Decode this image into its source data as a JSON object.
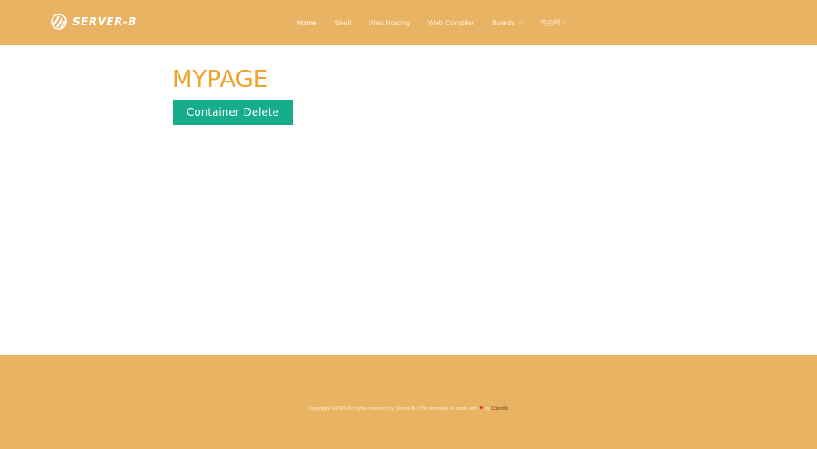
{
  "header": {
    "logo_text": "SERVER-B",
    "nav": [
      {
        "label": "Home",
        "active": true,
        "dropdown": false
      },
      {
        "label": "Shell",
        "active": false,
        "dropdown": false
      },
      {
        "label": "Web Hosting",
        "active": false,
        "dropdown": false
      },
      {
        "label": "Web Compiler",
        "active": false,
        "dropdown": false
      },
      {
        "label": "Boards",
        "active": false,
        "dropdown": true
      },
      {
        "label": "백승혁",
        "active": false,
        "dropdown": true
      }
    ]
  },
  "main": {
    "title": "MYPAGE",
    "delete_button": "Container Delete"
  },
  "footer": {
    "copyright": "Copyright ©2020 All rights reserved by Server-B | This template is made with",
    "by": "by",
    "link": "Colorlib"
  },
  "colors": {
    "header_bg": "#e8b463",
    "title": "#f0a430",
    "button": "#16ad8a"
  }
}
